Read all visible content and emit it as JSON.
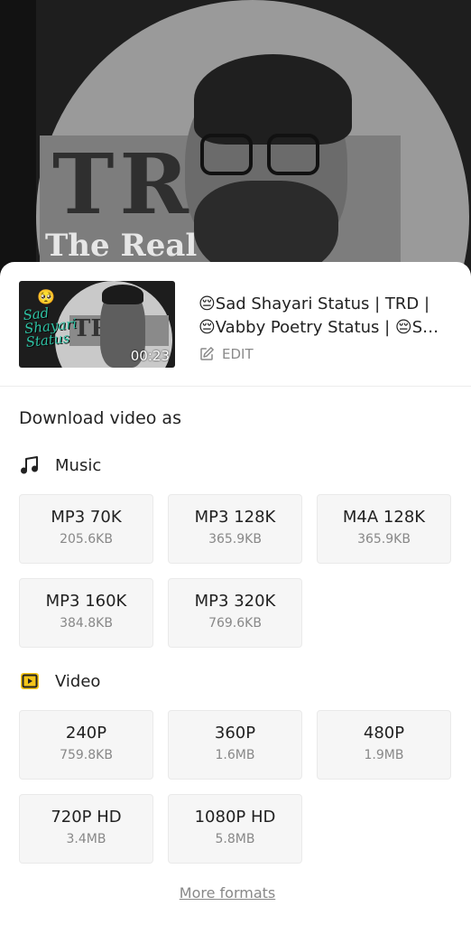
{
  "video": {
    "title": "😔Sad Shayari Status | TRD | 😔Vabby Poetry Status | 😔Sad Shayari Status",
    "duration": "00:23",
    "edit_label": "EDIT",
    "thumb_emoji": "🥺",
    "thumb_script": "Sad Shayari Status",
    "thumb_logo": "TRD",
    "bg_logo": "TRD:",
    "bg_logo_sub": "The Real Dice"
  },
  "download": {
    "heading": "Download video as",
    "music": {
      "label": "Music",
      "options": [
        {
          "label": "MP3 70K",
          "size": "205.6KB"
        },
        {
          "label": "MP3 128K",
          "size": "365.9KB"
        },
        {
          "label": "M4A 128K",
          "size": "365.9KB"
        },
        {
          "label": "MP3 160K",
          "size": "384.8KB"
        },
        {
          "label": "MP3 320K",
          "size": "769.6KB"
        }
      ]
    },
    "video": {
      "label": "Video",
      "options": [
        {
          "label": "240P",
          "size": "759.8KB"
        },
        {
          "label": "360P",
          "size": "1.6MB"
        },
        {
          "label": "480P",
          "size": "1.9MB"
        },
        {
          "label": "720P HD",
          "size": "3.4MB"
        },
        {
          "label": "1080P HD",
          "size": "5.8MB"
        }
      ]
    },
    "more_formats": "More formats"
  },
  "colors": {
    "accent_video_icon": "#f5c518",
    "text": "#222222",
    "muted": "#888888"
  },
  "icons": {
    "music": "music-note-icon",
    "video": "video-play-icon",
    "edit": "edit-icon"
  }
}
